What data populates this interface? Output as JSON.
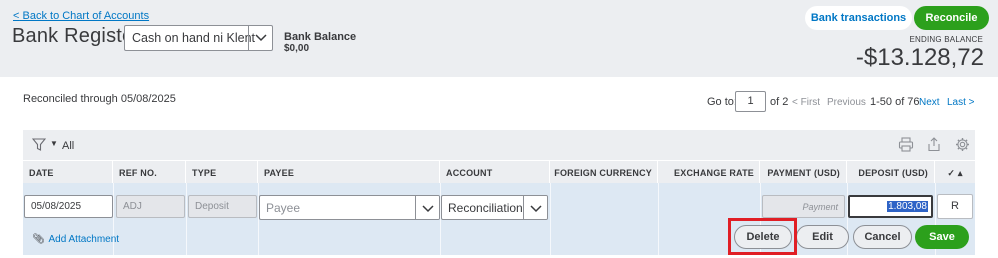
{
  "header": {
    "back_link": "Back to Chart of Accounts",
    "back_chevron": "<",
    "title": "Bank Register",
    "account_select_value": "Cash on hand ni Klent",
    "bank_balance_label": "Bank Balance",
    "bank_balance_value": "$0,00",
    "bank_transactions_button": "Bank transactions",
    "reconcile_button": "Reconcile",
    "ending_balance_label": "ENDING BALANCE",
    "ending_balance_value": "-$13.128,72"
  },
  "status": {
    "reconciled_through": "Reconciled through 05/08/2025"
  },
  "pagination": {
    "goto_label": "Go to:",
    "page_value": "1",
    "of_label": "of 2",
    "first": "< First",
    "previous": "Previous",
    "range": "1-50 of 76",
    "next": "Next",
    "last": "Last >"
  },
  "toolbar": {
    "filter_label": "All",
    "icons": [
      "filter-icon",
      "print-icon",
      "export-icon",
      "settings-icon"
    ]
  },
  "table": {
    "columns": [
      "DATE",
      "REF NO.",
      "TYPE",
      "PAYEE",
      "ACCOUNT",
      "FOREIGN CURRENCY",
      "EXCHANGE RATE",
      "PAYMENT (USD)",
      "DEPOSIT (USD)"
    ],
    "sort_indicator": "✓ ▴"
  },
  "edit_row": {
    "date": "05/08/2025",
    "ref_no": "ADJ",
    "type": "Deposit",
    "payee_placeholder": "Payee",
    "account": "Reconciliation D",
    "payment_placeholder": "Payment",
    "deposit": "1.803,08",
    "status": "R",
    "add_attachment": "Add Attachment",
    "buttons": {
      "delete": "Delete",
      "edit": "Edit",
      "cancel": "Cancel",
      "save": "Save"
    }
  },
  "colors": {
    "accent_green": "#2ca01c",
    "link_blue": "#0077c5",
    "highlight_red": "#e01e25",
    "row_blue": "#dde8f3"
  }
}
